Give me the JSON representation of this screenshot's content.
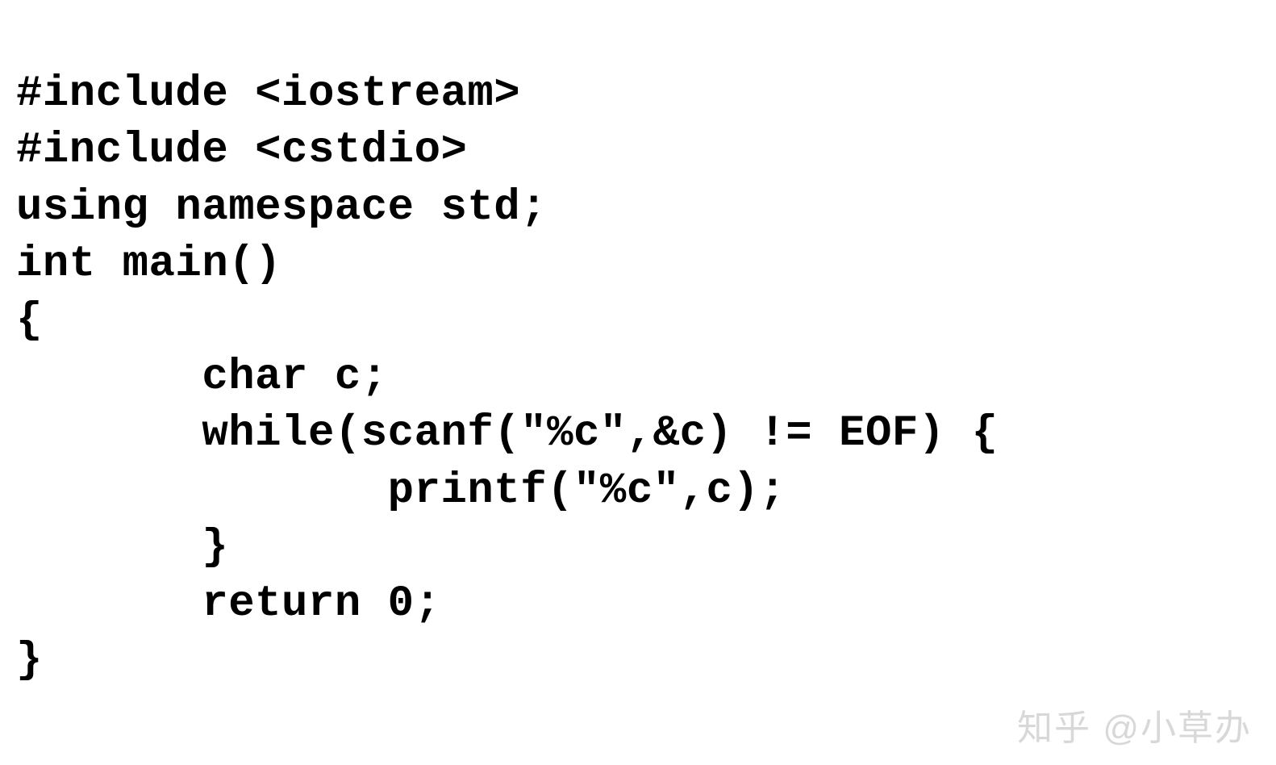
{
  "code": {
    "lines": [
      "#include <iostream>",
      "#include <cstdio>",
      "using namespace std;",
      "int main()",
      "{",
      "       char c;",
      "       while(scanf(\"%c\",&c) != EOF) {",
      "              printf(\"%c\",c);",
      "       }",
      "       return 0;",
      "}"
    ]
  },
  "watermark": {
    "text": "知乎 @小草办"
  }
}
